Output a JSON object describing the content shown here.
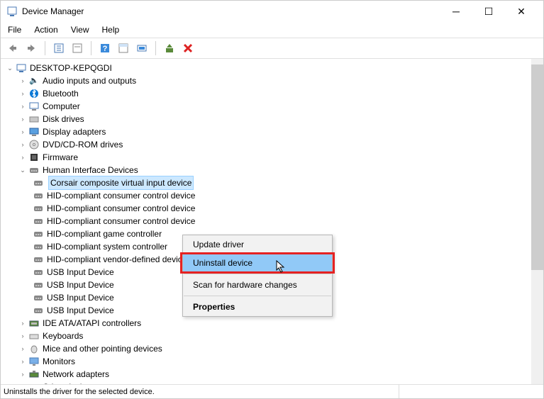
{
  "window": {
    "title": "Device Manager"
  },
  "menus": {
    "file": "File",
    "action": "Action",
    "view": "View",
    "help": "Help"
  },
  "tree": {
    "root": "DESKTOP-KEPQGDI",
    "cats": [
      {
        "label": "Audio inputs and outputs",
        "icon": "speaker"
      },
      {
        "label": "Bluetooth",
        "icon": "bluetooth"
      },
      {
        "label": "Computer",
        "icon": "computer"
      },
      {
        "label": "Disk drives",
        "icon": "disk"
      },
      {
        "label": "Display adapters",
        "icon": "display"
      },
      {
        "label": "DVD/CD-ROM drives",
        "icon": "cd"
      },
      {
        "label": "Firmware",
        "icon": "firmware"
      },
      {
        "label": "Human Interface Devices",
        "icon": "hid",
        "expanded": true
      },
      {
        "label": "IDE ATA/ATAPI controllers",
        "icon": "ide"
      },
      {
        "label": "Keyboards",
        "icon": "keyboard"
      },
      {
        "label": "Mice and other pointing devices",
        "icon": "mouse"
      },
      {
        "label": "Monitors",
        "icon": "monitor"
      },
      {
        "label": "Network adapters",
        "icon": "network"
      },
      {
        "label": "Other devices",
        "icon": "other"
      }
    ],
    "hid_children": [
      "Corsair composite virtual input device",
      "HID-compliant consumer control device",
      "HID-compliant consumer control device",
      "HID-compliant consumer control device",
      "HID-compliant game controller",
      "HID-compliant system controller",
      "HID-compliant vendor-defined device",
      "USB Input Device",
      "USB Input Device",
      "USB Input Device",
      "USB Input Device"
    ]
  },
  "context": {
    "update": "Update driver",
    "uninstall": "Uninstall device",
    "scan": "Scan for hardware changes",
    "properties": "Properties"
  },
  "status": "Uninstalls the driver for the selected device.",
  "colors": {
    "selection": "#cce8ff",
    "highlight": "#91c9f7",
    "redbox": "#e52222"
  }
}
